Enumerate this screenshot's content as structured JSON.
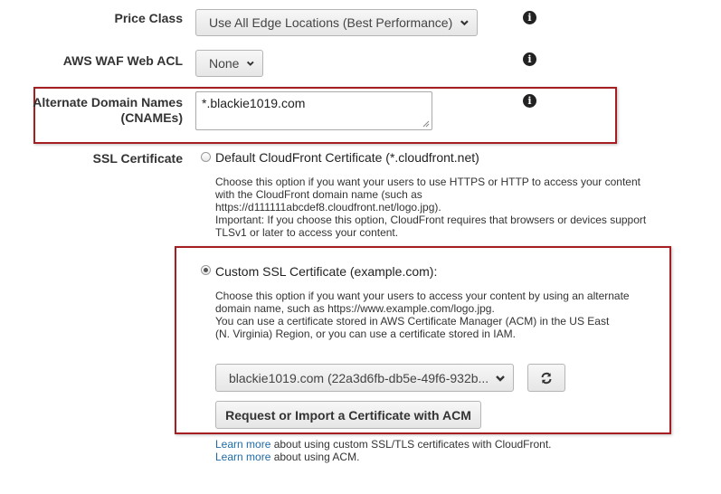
{
  "price_class": {
    "label": "Price Class",
    "value": "Use All Edge Locations (Best Performance)"
  },
  "waf": {
    "label": "AWS WAF Web ACL",
    "value": "None"
  },
  "cnames": {
    "label_line1": "Alternate Domain Names",
    "label_line2": "(CNAMEs)",
    "value": "*.blackie1019.com"
  },
  "ssl": {
    "label": "SSL Certificate",
    "default_option": {
      "label": "Default CloudFront Certificate (*.cloudfront.net)",
      "desc_lines": [
        "Choose this option if you want your users to use HTTPS or HTTP to access your content",
        "with the CloudFront domain name (such as",
        "https://d111111abcdef8.cloudfront.net/logo.jpg).",
        "Important: If you choose this option, CloudFront requires that browsers or devices support",
        "TLSv1 or later to access your content."
      ]
    },
    "custom_option": {
      "label": "Custom SSL Certificate (example.com):",
      "desc_lines": [
        "Choose this option if you want your users to access your content by using an alternate",
        "domain name, such as https://www.example.com/logo.jpg.",
        "You can use a certificate stored in AWS Certificate Manager (ACM) in the US East",
        "(N. Virginia) Region, or you can use a certificate stored in IAM."
      ],
      "certificate_value": "blackie1019.com (22a3d6fb-db5e-49f6-932b...",
      "request_button": "Request or Import a Certificate with ACM"
    },
    "footer": [
      {
        "link": "Learn more",
        "text": " about using custom SSL/TLS certificates with CloudFront."
      },
      {
        "link": "Learn more",
        "text": " about using ACM."
      }
    ]
  },
  "icons": [
    "info-icon",
    "chevron-down-icon",
    "refresh-icon"
  ],
  "colors": {
    "highlight_border": "#a51e22",
    "link": "#1f6aa5"
  }
}
